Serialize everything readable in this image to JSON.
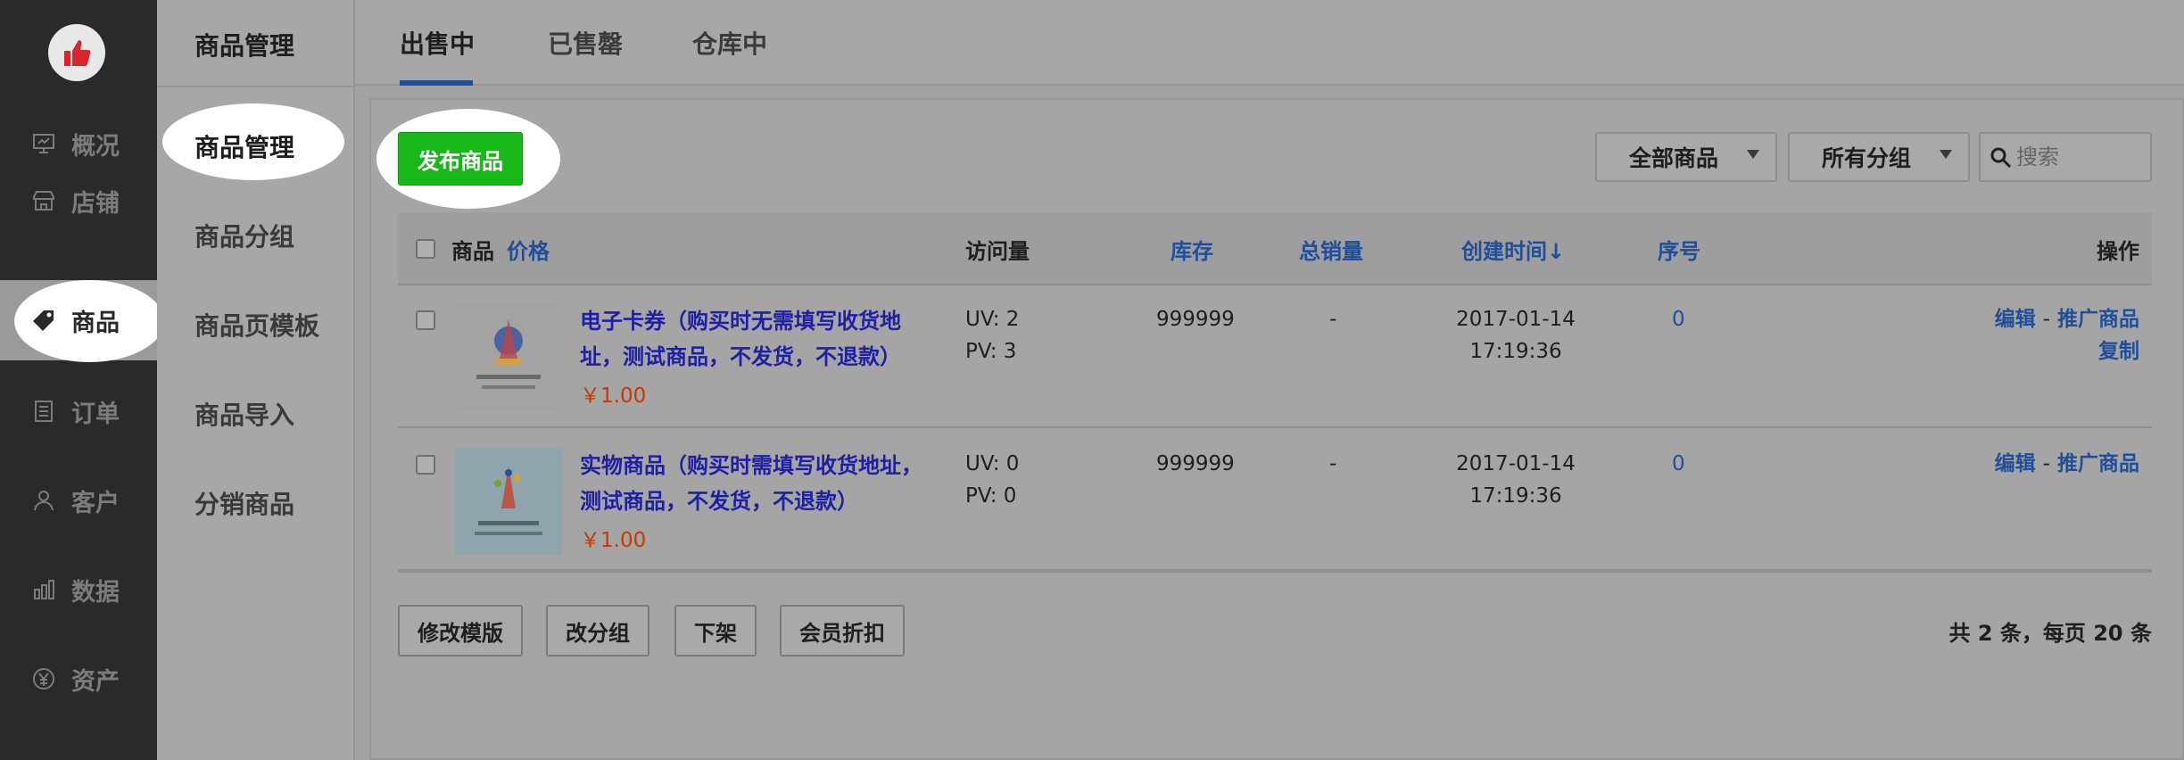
{
  "nav": {
    "items": [
      {
        "label": "概况",
        "icon": "overview-icon"
      },
      {
        "label": "店铺",
        "icon": "store-icon"
      },
      {
        "label": "商品",
        "icon": "tag-icon"
      },
      {
        "label": "订单",
        "icon": "order-icon"
      },
      {
        "label": "客户",
        "icon": "customer-icon"
      },
      {
        "label": "数据",
        "icon": "data-icon"
      },
      {
        "label": "资产",
        "icon": "assets-icon"
      }
    ]
  },
  "subnav": {
    "title": "商品管理",
    "items": [
      "商品管理",
      "商品分组",
      "商品页模板",
      "商品导入",
      "分销商品"
    ]
  },
  "tabs": [
    "出售中",
    "已售罄",
    "仓库中"
  ],
  "toolbar": {
    "publish_label": "发布商品",
    "filter_all": "全部商品",
    "filter_group": "所有分组",
    "search_placeholder": "搜索"
  },
  "table": {
    "headers": {
      "product": "商品",
      "price": "价格",
      "visits": "访问量",
      "stock": "库存",
      "sales": "总销量",
      "created": "创建时间↓",
      "order": "序号",
      "ops": "操作"
    },
    "rows": [
      {
        "name": "电子卡券（购买时无需填写收货地址，测试商品，不发货，不退款）",
        "price": "￥1.00",
        "uv": "UV: 2",
        "pv": "PV: 3",
        "stock": "999999",
        "sales": "-",
        "date": "2017-01-14",
        "time": "17:19:36",
        "order": "0",
        "op_edit": "编辑",
        "op_sep": "-",
        "op_promote": "推广商品",
        "op_copy": "复制"
      },
      {
        "name": "实物商品（购买时需填写收货地址，测试商品，不发货，不退款）",
        "price": "￥1.00",
        "uv": "UV: 0",
        "pv": "PV: 0",
        "stock": "999999",
        "sales": "-",
        "date": "2017-01-14",
        "time": "17:19:36",
        "order": "0",
        "op_edit": "编辑",
        "op_sep": "-",
        "op_promote": "推广商品"
      }
    ]
  },
  "bottom": {
    "btn_template": "修改模版",
    "btn_group": "改分组",
    "btn_offshelf": "下架",
    "btn_discount": "会员折扣",
    "pager": "共 2 条，每页 20 条"
  },
  "colors": {
    "sidebar_bg": "#2a2a2a",
    "publish_green": "#18b818",
    "link_blue": "#1f4f9b",
    "product_name_blue": "#1f1fa6",
    "price_orange": "#c43a00"
  }
}
